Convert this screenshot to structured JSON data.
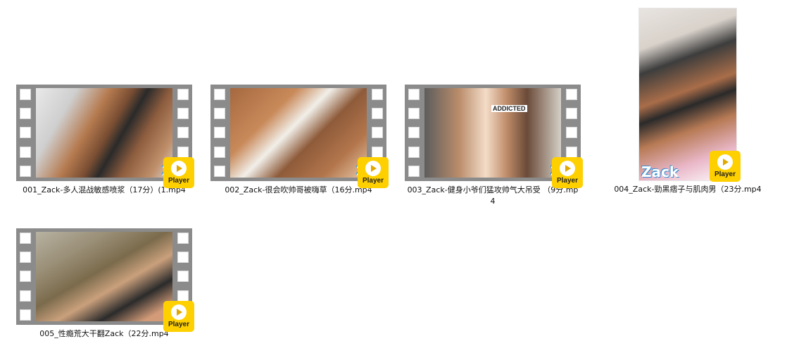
{
  "files": [
    {
      "name": "001_Zack-多人混战敏感喷浆（17分）(1.mp4",
      "badge": "Player",
      "watermark": "Z"
    },
    {
      "name": "002_Zack-很会吹帅哥被嗨草（16分.mp4",
      "badge": "Player",
      "watermark": "Z",
      "frame_text": ""
    },
    {
      "name": "003_Zack-健身小爷们猛攻帅气大吊受 （9分.mp4",
      "badge": "Player",
      "watermark": "Z",
      "frame_text": "ADDICTED"
    },
    {
      "name": "004_Zack-勁黑痞子与肌肉男（23分.mp4",
      "badge": "Player",
      "watermark": "Zack"
    },
    {
      "name": "005_性瘾荒大干翻Zack（22分.mp4",
      "badge": "Player",
      "watermark": ""
    }
  ],
  "colors": {
    "badge": "#ffd000",
    "film": "#8b8b8b",
    "watermark_outline": "#3b8fd1"
  },
  "icons": {
    "badge_icon": "play-icon"
  }
}
